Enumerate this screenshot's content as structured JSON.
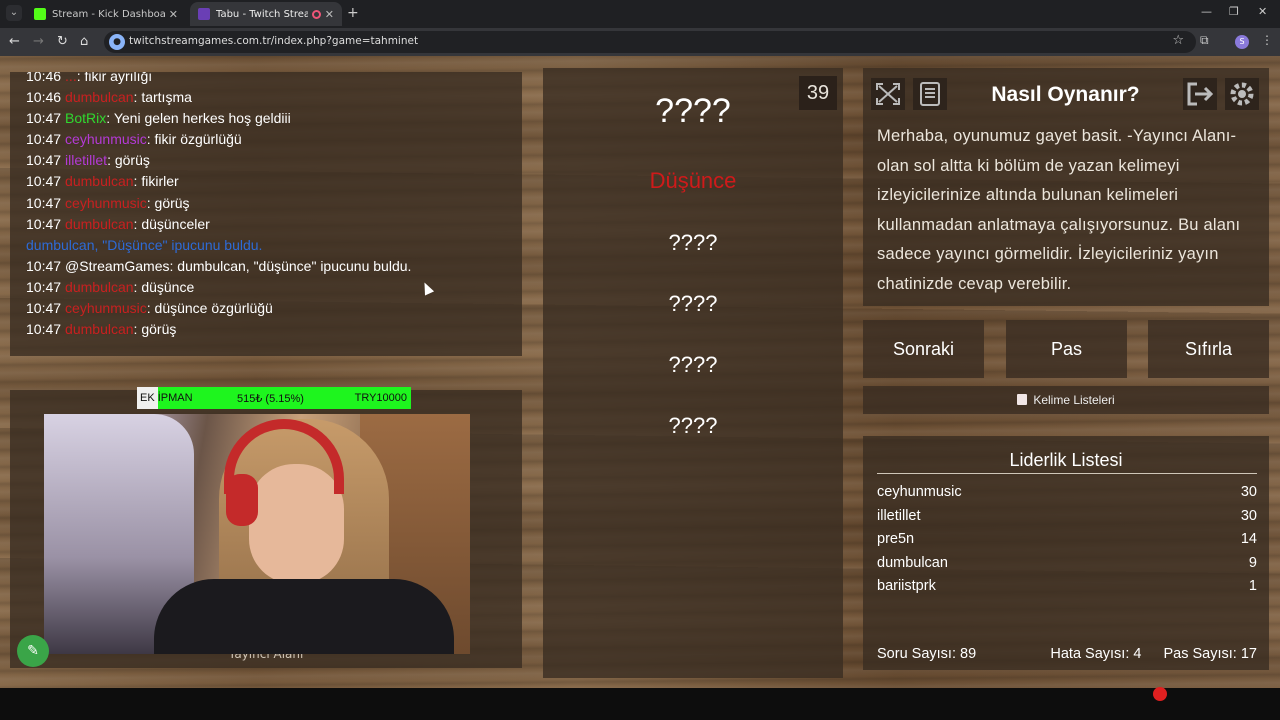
{
  "browser": {
    "tabs": [
      {
        "title": "Stream - Kick Dashboard",
        "favicon_color": "#53fc18",
        "active": false
      },
      {
        "title": "Tabu - Twitch Stream Game",
        "favicon_color": "#6a3fb5",
        "active": true
      }
    ],
    "url": "twitchstreamgames.com.tr/index.php?game=tahminet",
    "profile_initial": "S"
  },
  "chat": {
    "messages": [
      {
        "time": "10:46",
        "user": "...",
        "user_color": "#c82020",
        "text": "fikir ayrılığı"
      },
      {
        "time": "10:46",
        "user": "dumbulcan",
        "user_color": "#c82020",
        "text": "tartışma"
      },
      {
        "time": "10:47",
        "user": "BotRix",
        "user_color": "#2fd92f",
        "text": "Yeni gelen herkes hoş geldiii"
      },
      {
        "time": "10:47",
        "user": "ceyhunmusic",
        "user_color": "#b43ad6",
        "text": "fikir özgürlüğü"
      },
      {
        "time": "10:47",
        "user": "illetillet",
        "user_color": "#b43ad6",
        "text": "görüş"
      },
      {
        "time": "10:47",
        "user": "dumbulcan",
        "user_color": "#c82020",
        "text": "fikirler"
      },
      {
        "time": "10:47",
        "user": "ceyhunmusic",
        "user_color": "#c82020",
        "text": "görüş"
      },
      {
        "time": "10:47",
        "user": "dumbulcan",
        "user_color": "#c82020",
        "text": "düşünceler"
      },
      {
        "time": "",
        "user": "",
        "user_color": "#2e6bd6",
        "text": "dumbulcan, \"Düşünce\" ipucunu buldu.",
        "notice": true
      },
      {
        "time": "10:47",
        "user": "@StreamGames",
        "user_color": "#ffffff",
        "text": "dumbulcan, \"düşünce\" ipucunu buldu."
      },
      {
        "time": "10:47",
        "user": "dumbulcan",
        "user_color": "#c82020",
        "text": "düşünce"
      },
      {
        "time": "10:47",
        "user": "ceyhunmusic",
        "user_color": "#c82020",
        "text": "düşünce özgürlüğü"
      },
      {
        "time": "10:47",
        "user": "dumbulcan",
        "user_color": "#c82020",
        "text": "görüş"
      }
    ]
  },
  "streamer": {
    "label": "Yayıncı Alanı",
    "overlay": {
      "tag": "EK",
      "tag_rest": "İPMAN",
      "amount": "515₺ (5.15%)",
      "goal": "TRY10000"
    }
  },
  "game": {
    "counter": "39",
    "main_word": "????",
    "found_hint": "Düşünce",
    "hints": [
      "????",
      "????",
      "????",
      "????"
    ]
  },
  "how_to": {
    "title": "Nasıl Oynanır?",
    "text": "Merhaba, oyunumuz gayet basit. -Yayıncı Alanı- olan sol altta ki bölüm de yazan kelimeyi izleyicilerinize altında bulunan kelimeleri kullanmadan anlatmaya çalışıyorsunuz. Bu alanı sadece yayıncı görmelidir. İzleyicileriniz yayın chatinizde cevap verebilir."
  },
  "actions": {
    "next": "Sonraki",
    "pass": "Pas",
    "reset": "Sıfırla",
    "word_lists": "Kelime Listeleri"
  },
  "leaderboard": {
    "title": "Liderlik Listesi",
    "rows": [
      {
        "name": "ceyhunmusic",
        "score": "30"
      },
      {
        "name": "illetillet",
        "score": "30"
      },
      {
        "name": "pre5n",
        "score": "14"
      },
      {
        "name": "dumbulcan",
        "score": "9"
      },
      {
        "name": "bariistprk",
        "score": "1"
      }
    ],
    "stats": {
      "questions": "Soru Sayısı: 89",
      "errors": "Hata Sayısı: 4",
      "passes": "Pas Sayısı: 17"
    }
  }
}
